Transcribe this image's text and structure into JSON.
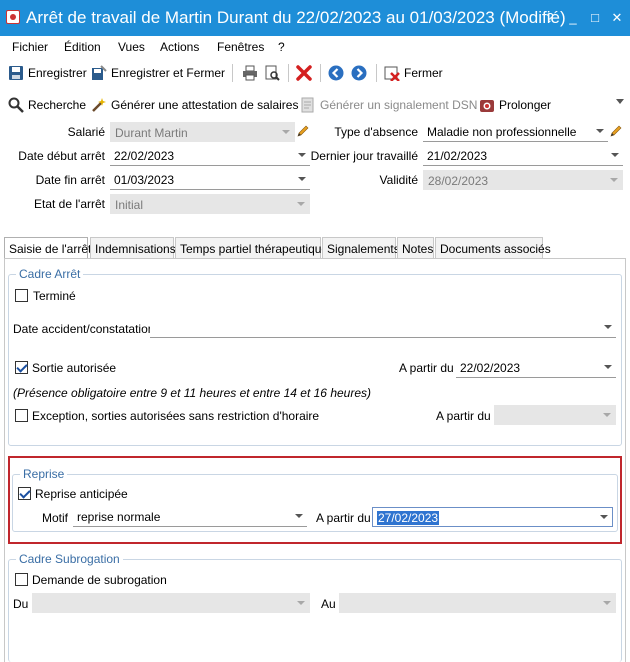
{
  "window": {
    "title": "Arrêt de travail de Martin Durant du 22/02/2023 au 01/03/2023 (Modifié)",
    "controls": [
      "?",
      "_",
      "□",
      "✕"
    ]
  },
  "menu": [
    "Fichier",
    "Édition",
    "Vues",
    "Actions",
    "Fenêtres",
    "?"
  ],
  "toolbar1": {
    "save": "Enregistrer",
    "save_close": "Enregistrer et Fermer",
    "close": "Fermer"
  },
  "toolbar2": {
    "search": "Recherche",
    "salary_cert": "Générer une attestation de salaires",
    "dsn_signal": "Générer un signalement DSN",
    "extend": "Prolonger"
  },
  "header": {
    "salarie_label": "Salarié",
    "salarie_value": "Durant Martin",
    "date_debut_label": "Date début arrêt",
    "date_debut_value": "22/02/2023",
    "date_fin_label": "Date fin arrêt",
    "date_fin_value": "01/03/2023",
    "etat_label": "Etat de l'arrêt",
    "etat_value": "Initial",
    "type_absence_label": "Type d'absence",
    "type_absence_value": "Maladie non professionnelle",
    "dernier_jour_label": "Dernier jour travaillé",
    "dernier_jour_value": "21/02/2023",
    "validite_label": "Validité",
    "validite_value": "28/02/2023"
  },
  "tabs": [
    "Saisie de l'arrêt",
    "Indemnisations",
    "Temps partiel thérapeutique",
    "Signalements",
    "Notes",
    "Documents associés"
  ],
  "cadre_arret": {
    "title": "Cadre Arrêt",
    "termine": "Terminé",
    "termine_checked": false,
    "date_accident_label": "Date accident/constatation",
    "date_accident_value": "",
    "sortie_autorisee": "Sortie autorisée",
    "sortie_checked": true,
    "a_partir_du_label": "A partir du",
    "sortie_date": "22/02/2023",
    "presence_note": "(Présence obligatoire entre 9 et 11 heures et entre 14 et 16 heures)",
    "exception": "Exception, sorties autorisées sans restriction d'horaire",
    "exception_checked": false,
    "exception_date": ""
  },
  "reprise": {
    "title": "Reprise",
    "anticipee": "Reprise anticipée",
    "anticipee_checked": true,
    "motif_label": "Motif",
    "motif_value": "reprise normale",
    "a_partir_du_label": "A partir du",
    "date_value": "27/02/2023"
  },
  "subrogation": {
    "title": "Cadre Subrogation",
    "demande": "Demande de subrogation",
    "demande_checked": false,
    "du_label": "Du",
    "au_label": "Au",
    "du_value": "",
    "au_value": ""
  },
  "colors": {
    "titlebar": "#1e8ed8",
    "group_title": "#3a6ea5",
    "highlight_border": "#c0262c",
    "selection": "#2f74d0"
  }
}
